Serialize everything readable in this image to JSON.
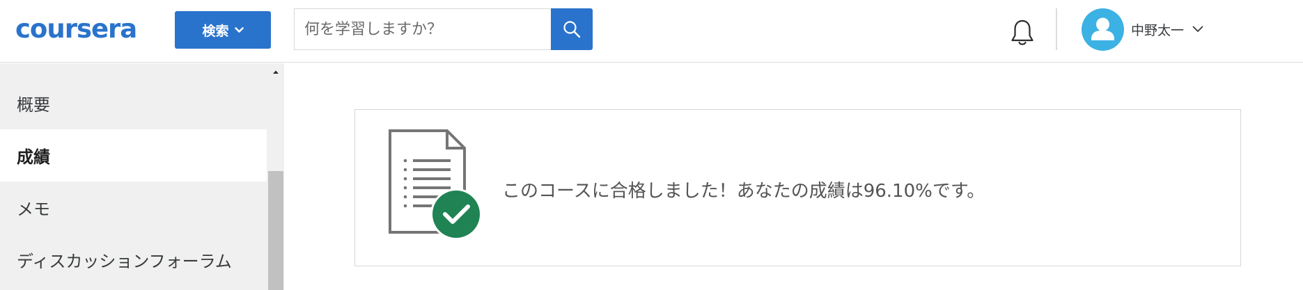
{
  "header": {
    "logo_text": "coursera",
    "explore_label": "検索",
    "search": {
      "placeholder": "何を学習しますか？",
      "value": ""
    },
    "user": {
      "name": "中野太一"
    }
  },
  "sidebar": {
    "items": [
      {
        "label": "概要",
        "active": false
      },
      {
        "label": "成績",
        "active": true
      },
      {
        "label": "メモ",
        "active": false
      },
      {
        "label": "ディスカッションフォーラム",
        "active": false
      }
    ]
  },
  "main": {
    "grade_message": "このコースに合格しました！あなたの成績は96.10%です。"
  },
  "icons": {
    "explore_chevron": "chevron-down-icon",
    "search": "search-icon",
    "notifications": "bell-icon",
    "avatar": "user-avatar-icon",
    "user_menu": "chevron-down-icon",
    "document": "document-icon",
    "check": "checkmark-badge-icon"
  },
  "colors": {
    "brand": "#2a73cc",
    "avatar": "#3cb1e3",
    "success": "#1f8354",
    "sidebar_bg": "#f0f0f0"
  }
}
